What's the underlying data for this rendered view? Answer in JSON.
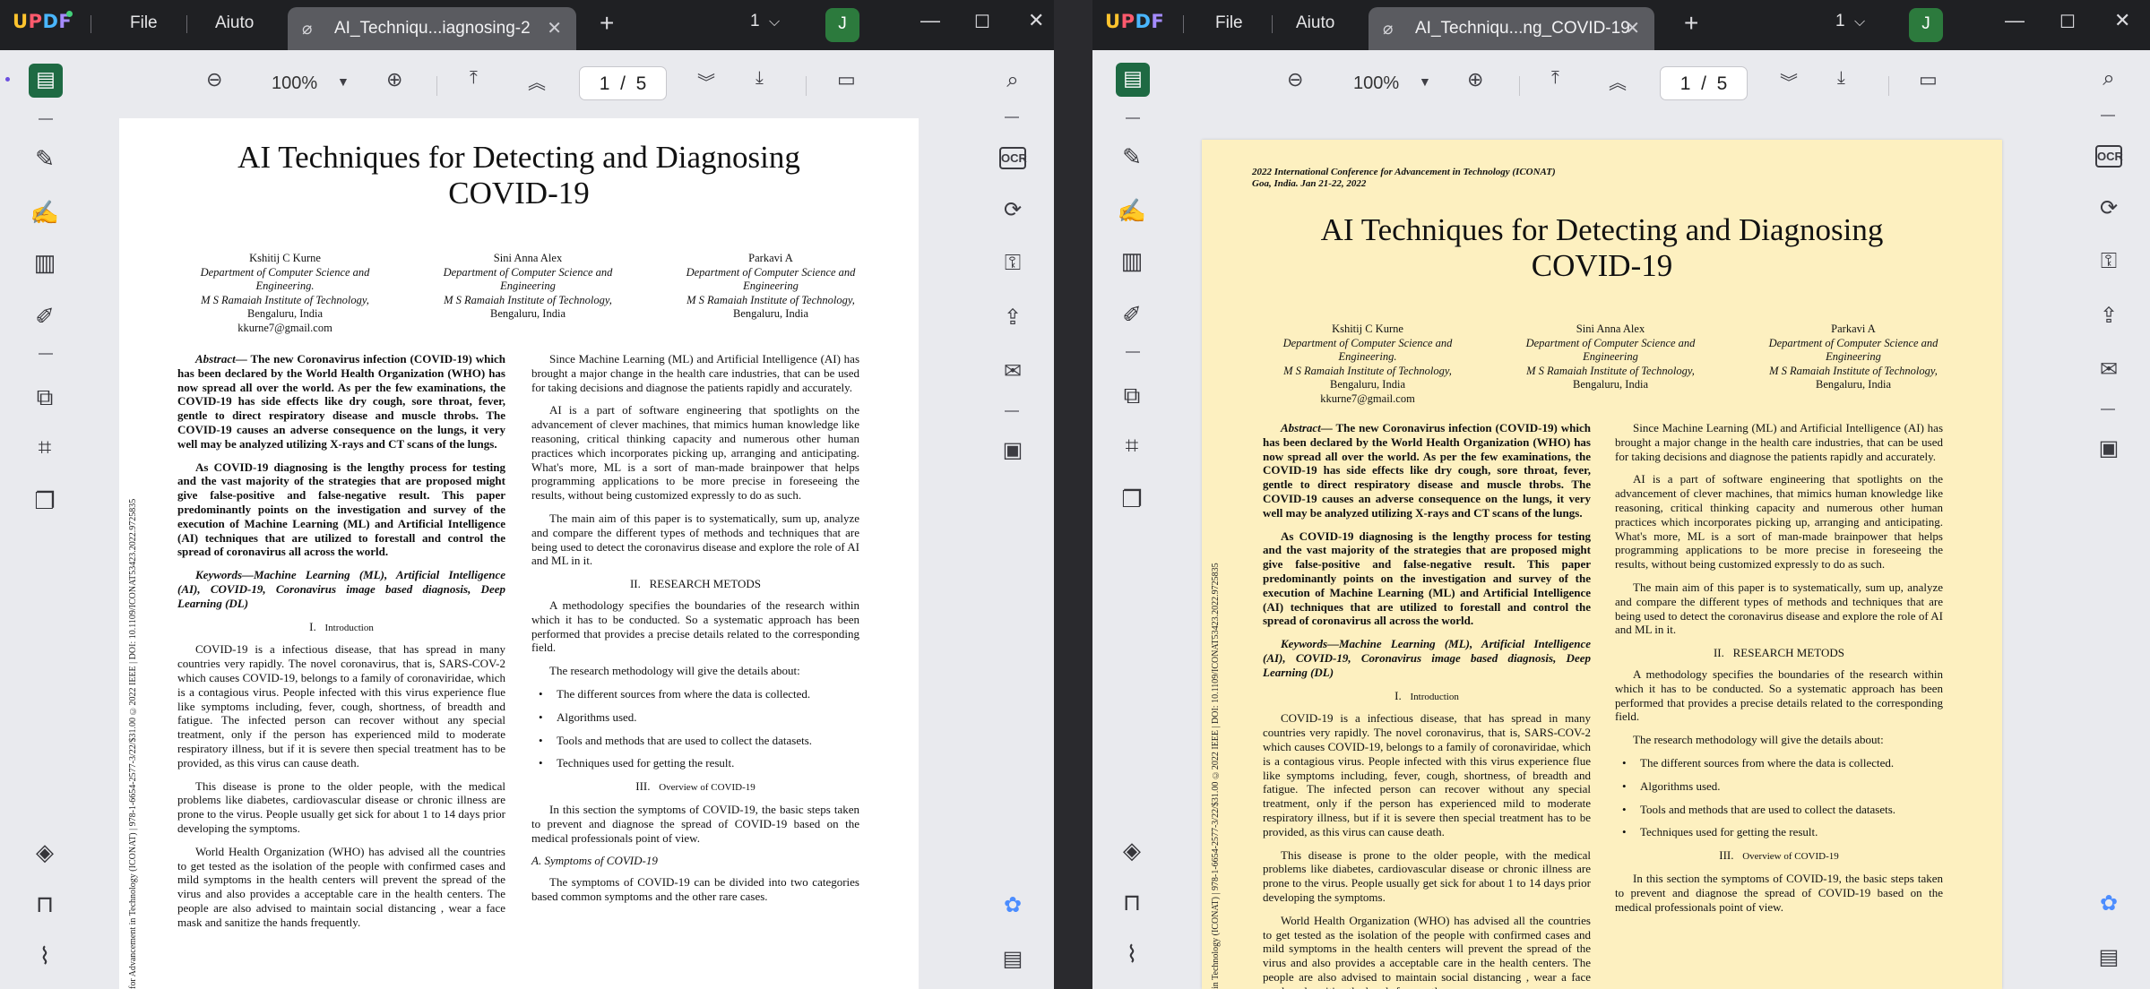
{
  "windows": [
    {
      "app": {
        "logo": "UPDF",
        "menu_file": "File",
        "menu_ai": "Aiuto"
      },
      "tab": {
        "title": "AI_Techniqu...iagnosing-2"
      },
      "tab_count": "1",
      "user": {
        "initial": "J"
      },
      "toolbar": {
        "zoom": "100%",
        "page_current": "1",
        "page_sep": "/",
        "page_total": "5"
      }
    },
    {
      "app": {
        "logo": "UPDF",
        "menu_file": "File",
        "menu_ai": "Aiuto"
      },
      "tab": {
        "title": "AI_Techniqu...ng_COVID-19"
      },
      "tab_count": "1",
      "user": {
        "initial": "J"
      },
      "toolbar": {
        "zoom": "100%",
        "page_current": "1",
        "page_sep": "/",
        "page_total": "5"
      }
    }
  ],
  "document": {
    "conference_line1": "2022 International Conference for Advancement in Technology (ICONAT)",
    "conference_line2": "Goa, India. Jan 21-22, 2022",
    "title_line1": "AI Techniques for Detecting and Diagnosing",
    "title_line2": "COVID-19",
    "authors": [
      {
        "name": "Kshitij C Kurne",
        "dept1": "Department of Computer Science and",
        "dept2": "Engineering.",
        "inst": "M S Ramaiah Institute of Technology,",
        "city": "Bengaluru, India",
        "email": "kkurne7@gmail.com"
      },
      {
        "name": "Sini Anna Alex",
        "dept1": "Department of Computer Science and",
        "dept2": "Engineering",
        "inst": "M S Ramaiah Institute of Technology,",
        "city": "Bengaluru, India",
        "email": ""
      },
      {
        "name": "Parkavi A",
        "dept1": "Department of Computer Science and",
        "dept2": "Engineering",
        "inst": "M S Ramaiah Institute of Technology,",
        "city": "Bengaluru, India",
        "email": ""
      }
    ],
    "doi_side_left": "for Advancement in Technology (ICONAT) | 978-1-6654-2577-3/22/$31.00 ©2022 IEEE | DOI: 10.1109/ICONAT53423.2022.9725835",
    "doi_side_right": "in Technology (ICONAT) | 978-1-6654-2577-3/22/$31.00 ©2022 IEEE | DOI: 10.1109/ICONAT53423.2022.9725835",
    "abstract_label": "Abstract",
    "abstract_p1": "— The new Coronavirus infection (COVID-19) which has been declared by the World Health Organization (WHO) has now spread all over the world. As per the few examinations, the COVID-19 has side effects like dry cough, sore throat, fever, gentle to direct respiratory disease and muscle throbs. The COVID-19 causes an adverse consequence on the lungs, it very well may be analyzed utilizing X-rays and CT scans of the lungs.",
    "abstract_p2": "As COVID-19 diagnosing is the lengthy process for testing and the vast majority of the strategies that are proposed might give false-positive and false-negative result. This paper predominantly points on the investigation and survey of the execution of Machine Learning (ML) and Artificial Intelligence (AI) techniques that are utilized to forestall and control the spread of coronavirus all across the world.",
    "keywords": "Keywords—Machine Learning (ML), Artificial Intelligence (AI), COVID-19, Coronavirus image based diagnosis, Deep Learning (DL)",
    "sec1_num": "I.",
    "sec1_title": "Introduction",
    "intro_p1": "COVID-19 is a infectious disease, that has spread in many countries very rapidly. The novel coronavirus, that is, SARS-COV-2 which causes COVID-19, belongs to a family of coronaviridae, which is a contagious virus. People infected with this virus experience flue like symptoms including, fever, cough, shortness, of breadth and fatigue. The infected person can recover without any special treatment, only if the person has experienced mild to moderate respiratory illness, but if it is severe then special treatment has to be provided, as this virus can cause death.",
    "intro_p2": "This disease is prone to the older people, with the medical problems like diabetes, cardiovascular disease or chronic illness are prone to the virus. People usually get sick for about 1 to 14 days prior developing the symptoms.",
    "intro_p3": "World Health Organization (WHO) has advised all the countries to get tested as the isolation of the people with confirmed cases and mild symptoms in the health centers will prevent the spread of the virus and also provides a acceptable care in the health centers. The people are also advised to maintain social distancing , wear a face mask and sanitize the hands frequently.",
    "r_p1": "Since Machine Learning (ML) and Artificial Intelligence (AI) has brought a major change in the health care industries, that can be used for taking decisions and diagnose the patients rapidly and accurately.",
    "r_p2": "AI is a part of software engineering that spotlights on the advancement of clever machines, that mimics human knowledge like reasoning, critical thinking capacity and numerous other human practices which incorporates picking up, arranging and anticipating. What's more, ML is a sort of man-made brainpower that helps programming applications to be more precise in foreseeing the results, without being customized expressly to do as such.",
    "r_p3": "The main aim of this paper is to systematically, sum up, analyze and compare the different types of methods and techniques that are being used to detect the coronavirus disease and explore the role of AI and ML in it.",
    "sec2_num": "II.",
    "sec2_title": "RESEARCH METODS",
    "r_p4": "A methodology specifies the boundaries of the research within which it has to be conducted. So a systematic approach has been performed that provides a precise details related to the corresponding field.",
    "r_p5": "The research methodology will give the details about:",
    "bullets": [
      "The different sources from where the data is collected.",
      "Algorithms used.",
      "Tools and methods that are used to collect the datasets.",
      "Techniques used for getting the result."
    ],
    "sec3_num": "III.",
    "sec3_title": "Overview of COVID-19",
    "r_p6": "In this section the symptoms of COVID-19, the basic steps taken to prevent and diagnose the spread of COVID-19 based on the medical professionals point of view.",
    "subsec_a": "A.   Symptoms of COVID-19",
    "r_p7": "The symptoms of COVID-19 can be divided into two categories based common symptoms and the other rare cases."
  },
  "colors": {
    "accent_green": "#1e6a43",
    "page_highlight": "#fdf0c0",
    "titlebar": "#1f2023"
  }
}
